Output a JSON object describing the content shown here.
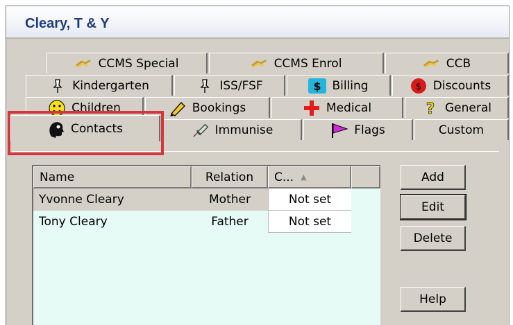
{
  "window": {
    "title": "Cleary, T & Y"
  },
  "tabs": {
    "row1": [
      {
        "label": "CCMS Special",
        "icon": "handshake-icon"
      },
      {
        "label": "CCMS Enrol",
        "icon": "handshake-icon"
      },
      {
        "label": "CCB",
        "icon": "handshake-icon"
      }
    ],
    "row2": [
      {
        "label": "Kindergarten",
        "icon": "pin-icon"
      },
      {
        "label": "ISS/FSF",
        "icon": "pin-icon"
      },
      {
        "label": "Billing",
        "icon": "dollar-icon"
      },
      {
        "label": "Discounts",
        "icon": "discount-icon"
      }
    ],
    "row3": [
      {
        "label": "Children",
        "icon": "smiley-icon"
      },
      {
        "label": "Bookings",
        "icon": "pencil-icon"
      },
      {
        "label": "Medical",
        "icon": "medical-cross-icon"
      },
      {
        "label": "General",
        "icon": "question-icon"
      }
    ],
    "row4": [
      {
        "label": "Contacts",
        "icon": "contact-head-icon",
        "selected": true
      },
      {
        "label": "Immunise",
        "icon": "syringe-icon"
      },
      {
        "label": "Flags",
        "icon": "flag-icon"
      },
      {
        "label": "Custom",
        "icon": ""
      }
    ]
  },
  "contacts": {
    "columns": [
      "Name",
      "Relation",
      "C..."
    ],
    "rows": [
      {
        "name": "Yvonne Cleary",
        "relation": "Mother",
        "c": "Not set"
      },
      {
        "name": "Tony Cleary",
        "relation": "Father",
        "c": "Not set"
      }
    ]
  },
  "buttons": {
    "add": "Add",
    "edit": "Edit",
    "delete": "Delete",
    "help": "Help"
  },
  "colors": {
    "highlight_box": "#d3373b",
    "title_text": "#1f3d7a",
    "list_bg": "#e6fbf6",
    "dialog_bg": "#d4d0c8"
  }
}
